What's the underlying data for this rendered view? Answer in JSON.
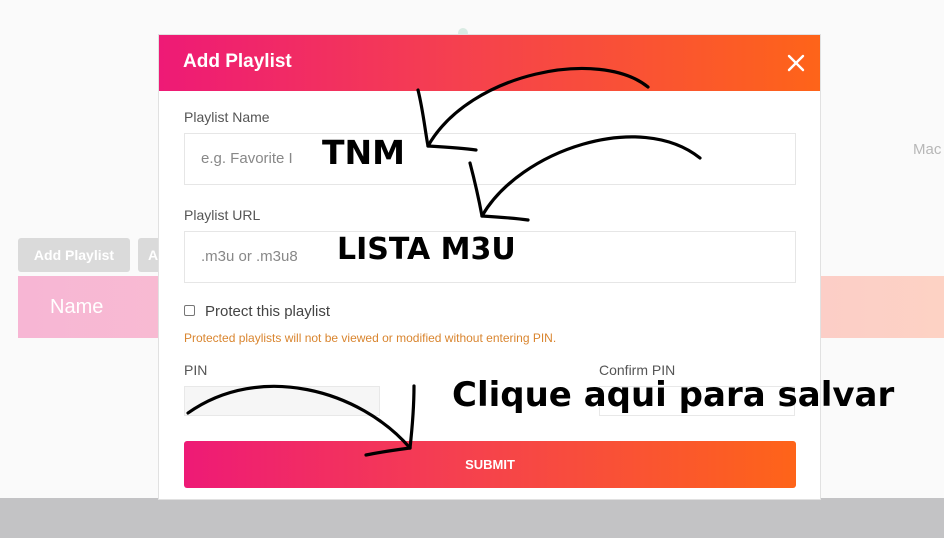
{
  "background": {
    "add_playlist_button": "Add Playlist",
    "second_button": "A",
    "table_header_name": "Name",
    "mac_label": "Mac"
  },
  "modal": {
    "title": "Add Playlist",
    "playlist_name_label": "Playlist Name",
    "playlist_name_placeholder": "e.g. Favorite I",
    "playlist_url_label": "Playlist URL",
    "playlist_url_placeholder": ".m3u or .m3u8",
    "protect_label": "Protect this playlist",
    "protect_hint": "Protected playlists will not be viewed or modified without entering PIN.",
    "pin_label": "PIN",
    "confirm_pin_label": "Confirm PIN",
    "submit_label": "SUBMIT"
  },
  "annotations": {
    "name_note": "TNM",
    "url_note": "LISTA M3U",
    "submit_note": "Clique aqui para salvar"
  },
  "colors": {
    "gradient_start": "#ee1a76",
    "gradient_end": "#fe6419",
    "hint_text": "#d9852f"
  }
}
